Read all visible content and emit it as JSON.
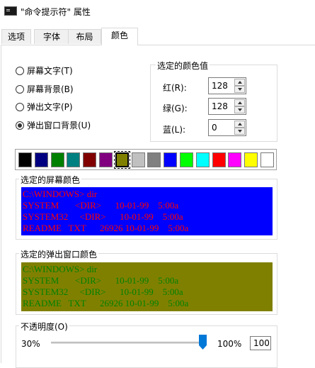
{
  "window": {
    "title": "\"命令提示符\" 属性"
  },
  "tabs": [
    {
      "label": "选项",
      "active": false
    },
    {
      "label": "字体",
      "active": false
    },
    {
      "label": "布局",
      "active": false
    },
    {
      "label": "颜色",
      "active": true
    }
  ],
  "target": {
    "options": [
      {
        "label": "屏幕文字(T)",
        "selected": false
      },
      {
        "label": "屏幕背景(B)",
        "selected": false
      },
      {
        "label": "弹出文字(P)",
        "selected": false
      },
      {
        "label": "弹出窗口背景(U)",
        "selected": true
      }
    ]
  },
  "selected_color": {
    "group_label": "选定的颜色值",
    "red": {
      "label": "红(R):",
      "value": "128"
    },
    "green": {
      "label": "绿(G):",
      "value": "128"
    },
    "blue": {
      "label": "蓝(L):",
      "value": "0"
    }
  },
  "palette": {
    "colors": [
      "#000000",
      "#000080",
      "#008000",
      "#008080",
      "#800000",
      "#800080",
      "#808000",
      "#c0c0c0",
      "#808080",
      "#0000ff",
      "#00ff00",
      "#00ffff",
      "#ff0000",
      "#ff00ff",
      "#ffff00",
      "#ffffff"
    ],
    "selected_index": 6
  },
  "screen_preview": {
    "group_label": "选定的屏幕颜色",
    "background": "#0000ff",
    "text_color": "#ff0000",
    "lines": [
      "C:\\WINDOWS> dir",
      "SYSTEM       <DIR>      10-01-99    5:00a",
      "SYSTEM32     <DIR>      10-01-99    5:00a",
      "README   TXT      26926 10-01-99    5:00a"
    ]
  },
  "popup_preview": {
    "group_label": "选定的弹出窗口颜色",
    "background": "#808000",
    "text_color": "#008000",
    "lines": [
      "C:\\WINDOWS> dir",
      "SYSTEM       <DIR>      10-01-99    5:00a",
      "SYSTEM32     <DIR>      10-01-99    5:00a",
      "README   TXT      26926 10-01-99    5:00a"
    ]
  },
  "opacity": {
    "group_label": "不透明度(O)",
    "min_label": "30%",
    "max_label": "100%",
    "value": "100",
    "percent": 100
  }
}
